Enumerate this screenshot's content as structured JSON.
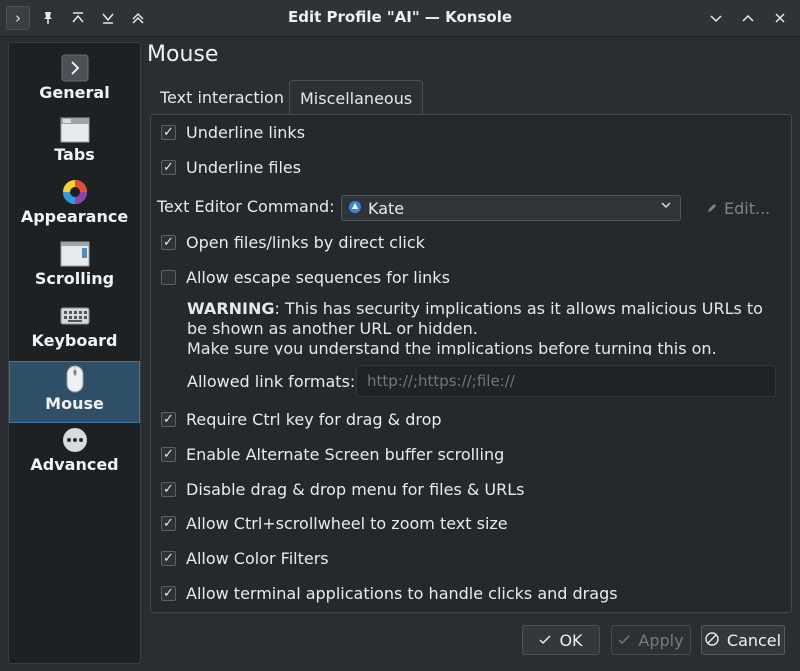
{
  "window": {
    "title": "Edit Profile \"AI\" — Konsole"
  },
  "titlebar_icons": {
    "left": [
      "app-menu-icon",
      "pin-icon",
      "keep-above-icon",
      "keep-below-icon",
      "shade-icon"
    ],
    "right": [
      "minimize-icon",
      "maximize-icon",
      "close-icon"
    ]
  },
  "sidebar": {
    "items": [
      {
        "label": "General",
        "icon": "chevron-right-icon"
      },
      {
        "label": "Tabs",
        "icon": "tabs-icon"
      },
      {
        "label": "Appearance",
        "icon": "color-wheel-icon"
      },
      {
        "label": "Scrolling",
        "icon": "scrollbar-icon"
      },
      {
        "label": "Keyboard",
        "icon": "keyboard-icon"
      },
      {
        "label": "Mouse",
        "icon": "mouse-icon",
        "selected": true
      },
      {
        "label": "Advanced",
        "icon": "ellipsis-icon"
      }
    ]
  },
  "page": {
    "title": "Mouse",
    "tabs": [
      {
        "label": "Text interaction",
        "active": false
      },
      {
        "label": "Miscellaneous",
        "active": true
      }
    ]
  },
  "misc": {
    "underline_links": {
      "label": "Underline links",
      "checked": true
    },
    "underline_files": {
      "label": "Underline files",
      "checked": true
    },
    "text_editor_label": "Text Editor Command:",
    "text_editor_value": "Kate",
    "edit_button": "Edit...",
    "open_by_click": {
      "label": "Open files/links by direct click",
      "checked": true
    },
    "escape_sequences": {
      "label": "Allow escape sequences for links",
      "checked": false
    },
    "warning_strong": "WARNING",
    "warning_text": ": This has security implications as it allows malicious URLs to be shown as another URL or hidden.",
    "warning_text2": "Make sure you understand the implications before turning this on.",
    "allowed_formats_label": "Allowed link formats:",
    "allowed_formats_placeholder": "http://;https://;file://",
    "require_ctrl": {
      "label": "Require Ctrl key for drag & drop",
      "checked": true
    },
    "alt_screen": {
      "label": "Enable Alternate Screen buffer scrolling",
      "checked": true
    },
    "disable_dnd_menu": {
      "label": "Disable drag & drop menu for files & URLs",
      "checked": true
    },
    "ctrl_scroll_zoom": {
      "label": "Allow Ctrl+scrollwheel to zoom text size",
      "checked": true
    },
    "color_filters": {
      "label": "Allow Color Filters",
      "checked": true
    },
    "terminal_clicks": {
      "label": "Allow terminal applications to handle clicks and drags",
      "checked": true
    }
  },
  "footer": {
    "ok": "OK",
    "apply": "Apply",
    "cancel": "Cancel"
  },
  "colors": {
    "selected_sidebar_bg": "#2f4f66",
    "panel_bg": "#25292d",
    "window_bg": "#2a2e32"
  }
}
